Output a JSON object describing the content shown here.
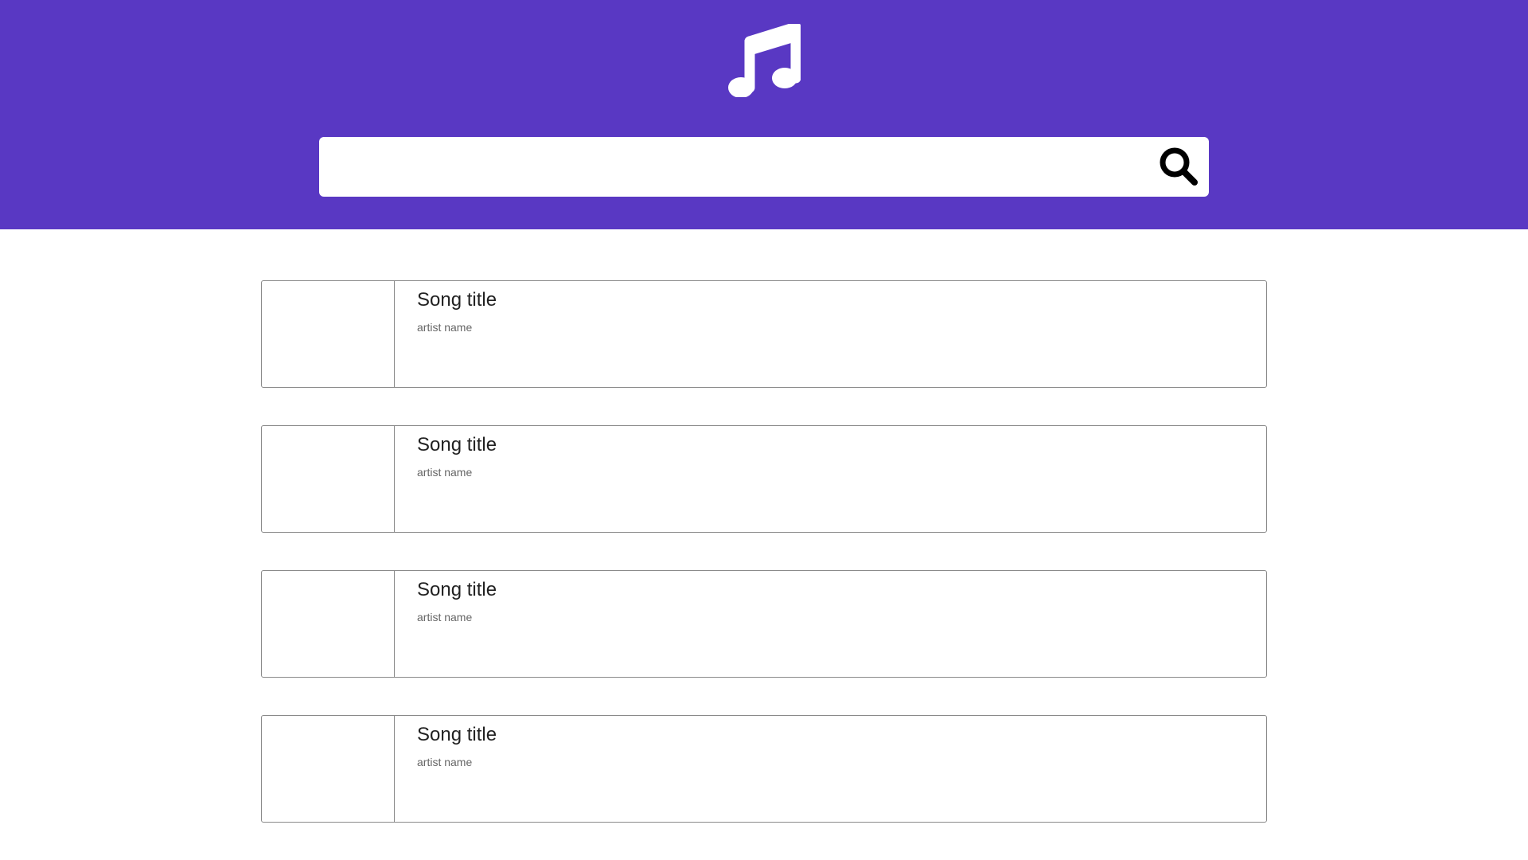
{
  "header": {
    "background_color": "#5938c3",
    "logo_icon": "music-note-icon",
    "search": {
      "value": "",
      "placeholder": "",
      "button_icon": "search-icon"
    }
  },
  "songs": [
    {
      "title": "Song title",
      "artist": "artist name"
    },
    {
      "title": "Song title",
      "artist": "artist name"
    },
    {
      "title": "Song title",
      "artist": "artist name"
    },
    {
      "title": "Song title",
      "artist": "artist name"
    }
  ]
}
